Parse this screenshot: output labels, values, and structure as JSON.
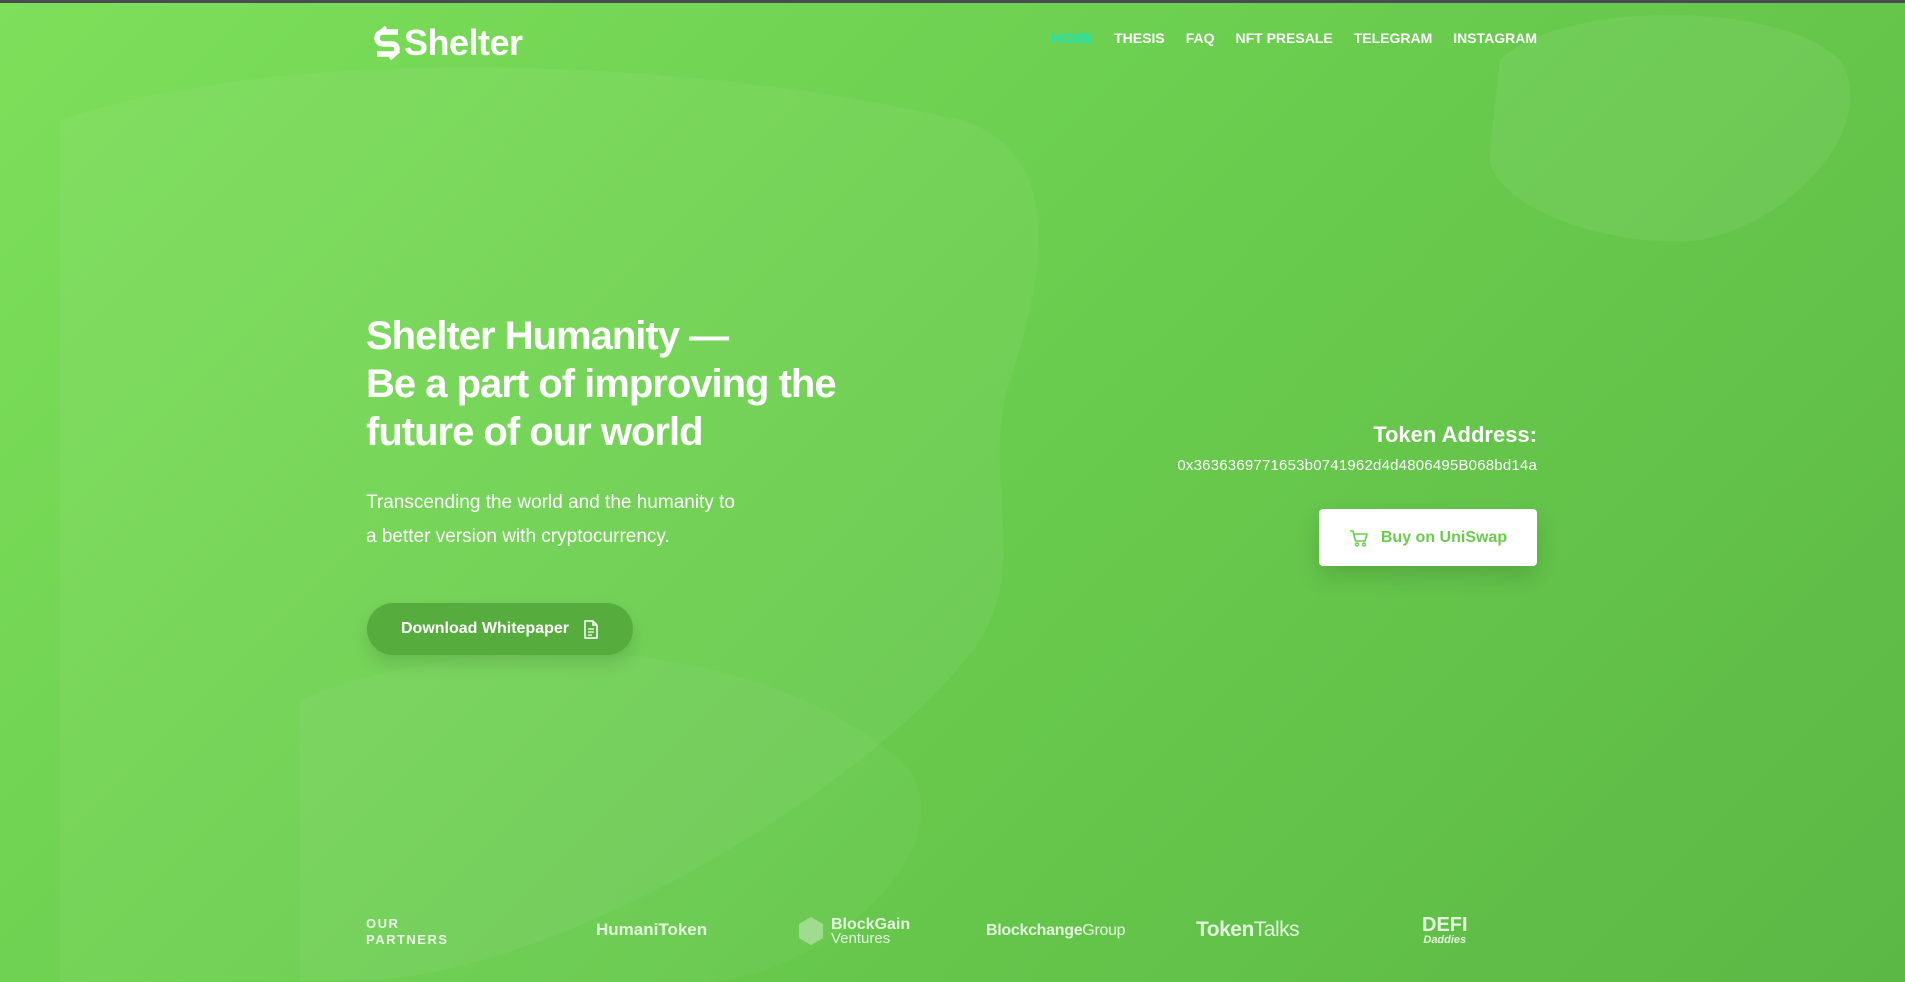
{
  "header": {
    "logo_text": "Shelter",
    "nav": [
      {
        "label": "HOME",
        "active": true
      },
      {
        "label": "THESIS"
      },
      {
        "label": "FAQ"
      },
      {
        "label": "NFT PRESALE"
      },
      {
        "label": "TELEGRAM"
      },
      {
        "label": "INSTAGRAM"
      }
    ]
  },
  "hero": {
    "title_lines": [
      "Shelter Humanity —",
      "Be a part of improving the",
      "future of our world"
    ],
    "subtitle_lines": [
      "Transcending the world and the humanity to",
      "a better version with cryptocurrency."
    ],
    "download_label": "Download Whitepaper"
  },
  "token": {
    "label": "Token Address:",
    "address": "0x3636369771653b0741962d4d4806495B068bd14a",
    "buy_label": "Buy on UniSwap"
  },
  "partners": {
    "label_lines": [
      "OUR",
      "PARTNERS"
    ],
    "items": [
      {
        "text": "HumaniToken"
      },
      {
        "line1": "BlockGain",
        "line2": "Ventures"
      },
      {
        "bold": "Blockchange",
        "light": "Group"
      },
      {
        "bold": "Token",
        "light": "Talks"
      },
      {
        "line1": "DEFI",
        "line2": "Daddies"
      }
    ]
  },
  "colors": {
    "bg_start": "#7ddf5a",
    "bg_end": "#5cb845",
    "nav_active": "#16e5c0",
    "download_button": "#57ac3e",
    "uniswap_text": "#6ccb4e"
  },
  "icons": {
    "download": "document-icon",
    "buy": "cart-icon"
  }
}
